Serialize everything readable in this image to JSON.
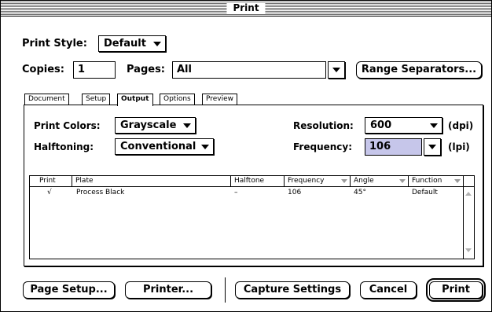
{
  "window": {
    "title": "Print"
  },
  "print_style": {
    "label": "Print Style:",
    "value": "Default"
  },
  "copies": {
    "label": "Copies:",
    "value": "1"
  },
  "pages": {
    "label": "Pages:",
    "value": "All"
  },
  "range_separators_label": "Range Separators...",
  "tabs": [
    {
      "label": "Document",
      "active": false
    },
    {
      "label": "Setup",
      "active": false
    },
    {
      "label": "Output",
      "active": true
    },
    {
      "label": "Options",
      "active": false
    },
    {
      "label": "Preview",
      "active": false
    }
  ],
  "output": {
    "print_colors": {
      "label": "Print Colors:",
      "value": "Grayscale"
    },
    "halftoning": {
      "label": "Halftoning:",
      "value": "Conventional"
    },
    "resolution": {
      "label": "Resolution:",
      "value": "600",
      "unit": "(dpi)"
    },
    "frequency": {
      "label": "Frequency:",
      "value": "106",
      "unit": "(lpi)"
    }
  },
  "plates_table": {
    "columns": [
      "Print",
      "Plate",
      "Halftone",
      "Frequency",
      "Angle",
      "Function"
    ],
    "rows": [
      {
        "print": "√",
        "plate": "Process Black",
        "halftone": "–",
        "frequency": "106",
        "angle": "45°",
        "function": "Default"
      }
    ]
  },
  "buttons": {
    "page_setup": "Page Setup...",
    "printer": "Printer...",
    "capture_settings": "Capture Settings",
    "cancel": "Cancel",
    "print": "Print"
  },
  "icons": {
    "popup_arrow": "triangle-down",
    "sort_arrow": "triangle-down",
    "scroll_up": "triangle-up",
    "scroll_down": "triangle-down"
  },
  "colors": {
    "selection_highlight": "#c6c6ea",
    "disabled_arrow": "#9a9a9a"
  }
}
